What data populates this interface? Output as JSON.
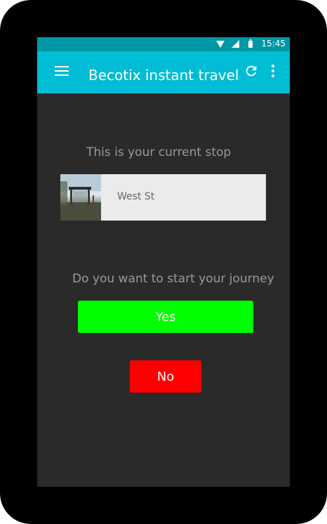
{
  "status_bar": {
    "time": "15:45",
    "icons": [
      "wifi-icon",
      "signal-icon",
      "battery-icon"
    ]
  },
  "app_bar": {
    "title": "Becotix instant travel",
    "icons": [
      "menu-icon",
      "refresh-icon",
      "overflow-menu-icon"
    ]
  },
  "content": {
    "current_stop_label": "This is your current stop",
    "stop_name": "West St",
    "journey_prompt": "Do you want to start your journey",
    "yes_label": "Yes",
    "no_label": "No"
  },
  "colors": {
    "status_bar": "#0097a7",
    "app_bar": "#00bcd4",
    "background": "#2a2a2a",
    "yes_button": "#00ff00",
    "no_button": "#ff0000"
  }
}
